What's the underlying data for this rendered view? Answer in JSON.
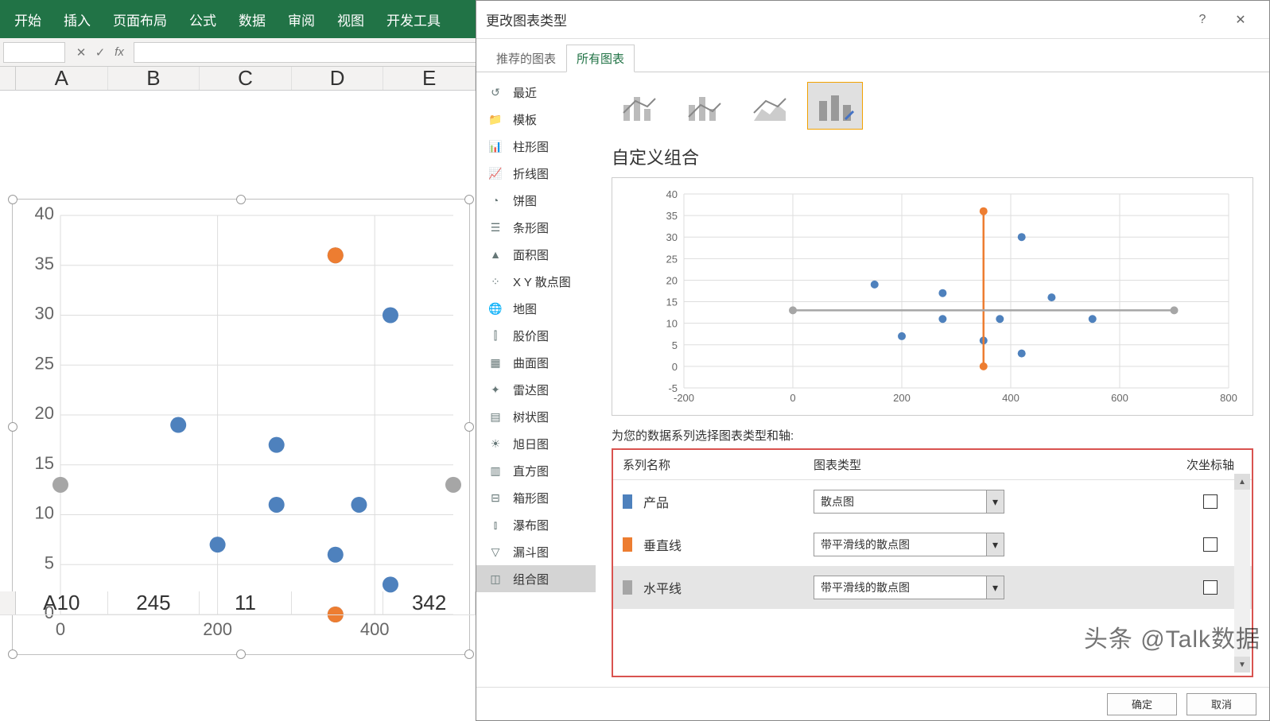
{
  "ribbon": {
    "tabs": [
      "开始",
      "插入",
      "页面布局",
      "公式",
      "数据",
      "审阅",
      "视图",
      "开发工具"
    ]
  },
  "formula_bar": {
    "cancel": "✕",
    "confirm": "✓",
    "fx": "fx"
  },
  "columns": [
    "A",
    "B",
    "C",
    "D",
    "E"
  ],
  "visible_row": {
    "label": "A10",
    "cells": [
      "245",
      "11",
      "",
      "342"
    ]
  },
  "dialog": {
    "title": "更改图表类型",
    "help": "?",
    "close": "✕",
    "tabs": [
      "推荐的图表",
      "所有图表"
    ],
    "active_tab": 1,
    "categories": [
      {
        "icon": "↺",
        "label": "最近"
      },
      {
        "icon": "folder",
        "label": "模板"
      },
      {
        "icon": "col",
        "label": "柱形图"
      },
      {
        "icon": "line",
        "label": "折线图"
      },
      {
        "icon": "pie",
        "label": "饼图"
      },
      {
        "icon": "bar",
        "label": "条形图"
      },
      {
        "icon": "area",
        "label": "面积图"
      },
      {
        "icon": "scatter",
        "label": "X Y 散点图"
      },
      {
        "icon": "globe",
        "label": "地图"
      },
      {
        "icon": "stock",
        "label": "股价图"
      },
      {
        "icon": "surface",
        "label": "曲面图"
      },
      {
        "icon": "radar",
        "label": "雷达图"
      },
      {
        "icon": "tree",
        "label": "树状图"
      },
      {
        "icon": "sun",
        "label": "旭日图"
      },
      {
        "icon": "hist",
        "label": "直方图"
      },
      {
        "icon": "box",
        "label": "箱形图"
      },
      {
        "icon": "water",
        "label": "瀑布图"
      },
      {
        "icon": "funnel",
        "label": "漏斗图"
      },
      {
        "icon": "combo",
        "label": "组合图"
      }
    ],
    "selected_category": 18,
    "combo_title": "自定义组合",
    "series_caption": "为您的数据系列选择图表类型和轴:",
    "hdr": {
      "name": "系列名称",
      "type": "图表类型",
      "sec": "次坐标轴"
    },
    "series": [
      {
        "color": "#4e81bd",
        "name": "产品",
        "type": "散点图",
        "sec": false,
        "sel": false
      },
      {
        "color": "#ed7d31",
        "name": "垂直线",
        "type": "带平滑线的散点图",
        "sec": false,
        "sel": false
      },
      {
        "color": "#a6a6a6",
        "name": "水平线",
        "type": "带平滑线的散点图",
        "sec": false,
        "sel": true
      }
    ],
    "buttons": {
      "ok": "确定",
      "cancel": "取消"
    }
  },
  "watermark": "头条 @Talk数据",
  "chart_data": {
    "type": "scatter",
    "title": "",
    "main_chart": {
      "xlim": [
        0,
        500
      ],
      "ylim": [
        0,
        40
      ],
      "xticks": [
        0,
        200,
        400
      ],
      "yticks": [
        0,
        5,
        10,
        15,
        20,
        25,
        30,
        35,
        40
      ],
      "series": [
        {
          "name": "产品",
          "color": "#4e81bd",
          "points": [
            [
              150,
              19
            ],
            [
              200,
              7
            ],
            [
              275,
              17
            ],
            [
              275,
              11
            ],
            [
              350,
              6
            ],
            [
              350,
              36
            ],
            [
              380,
              11
            ],
            [
              420,
              30
            ],
            [
              420,
              3
            ],
            [
              350,
              0
            ]
          ]
        },
        {
          "name": "垂直线",
          "color": "#ed7d31",
          "points": [
            [
              350,
              0
            ],
            [
              350,
              36
            ]
          ]
        },
        {
          "name": "水平线",
          "color": "#a6a6a6",
          "points": [
            [
              0,
              13
            ],
            [
              500,
              13
            ]
          ]
        }
      ]
    },
    "preview_chart": {
      "xlim": [
        -200,
        800
      ],
      "ylim": [
        -5,
        40
      ],
      "xticks": [
        -200,
        0,
        200,
        400,
        600,
        800
      ],
      "yticks": [
        -5,
        0,
        5,
        10,
        15,
        20,
        25,
        30,
        35,
        40
      ],
      "series": [
        {
          "name": "产品",
          "color": "#4e81bd",
          "points": [
            [
              150,
              19
            ],
            [
              200,
              7
            ],
            [
              275,
              17
            ],
            [
              275,
              11
            ],
            [
              350,
              6
            ],
            [
              380,
              11
            ],
            [
              420,
              3
            ],
            [
              420,
              30
            ],
            [
              475,
              16
            ],
            [
              550,
              11
            ]
          ]
        },
        {
          "name": "垂直线",
          "color": "#ed7d31",
          "line": true,
          "points": [
            [
              350,
              0
            ],
            [
              350,
              36
            ]
          ]
        },
        {
          "name": "水平线",
          "color": "#a6a6a6",
          "line": true,
          "points": [
            [
              0,
              13
            ],
            [
              700,
              13
            ]
          ]
        }
      ]
    }
  }
}
